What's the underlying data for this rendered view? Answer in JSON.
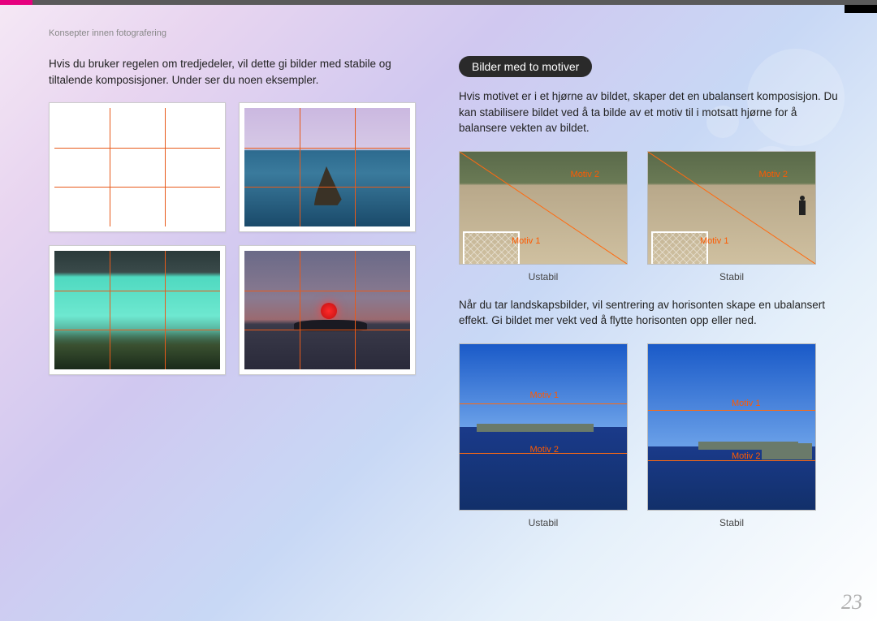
{
  "breadcrumb": "Konsepter innen fotografering",
  "left": {
    "intro": "Hvis du bruker regelen om tredjedeler, vil dette gi bilder med stabile og tiltalende komposisjoner. Under ser du noen eksempler."
  },
  "right": {
    "heading": "Bilder med to motiver",
    "para1": "Hvis motivet er i et hjørne av bildet, skaper det en ubalansert komposisjon. Du kan stabilisere bildet ved å ta bilde av et motiv til i motsatt hjørne for å balansere vekten av bildet.",
    "motiv1": "Motiv 1",
    "motiv2": "Motiv 2",
    "cap_unstable": "Ustabil",
    "cap_stable": "Stabil",
    "para2": "Når du tar landskapsbilder, vil sentrering av horisonten skape en ubalansert effekt. Gi bildet mer vekt ved å flytte horisonten opp eller ned."
  },
  "page_number": "23"
}
